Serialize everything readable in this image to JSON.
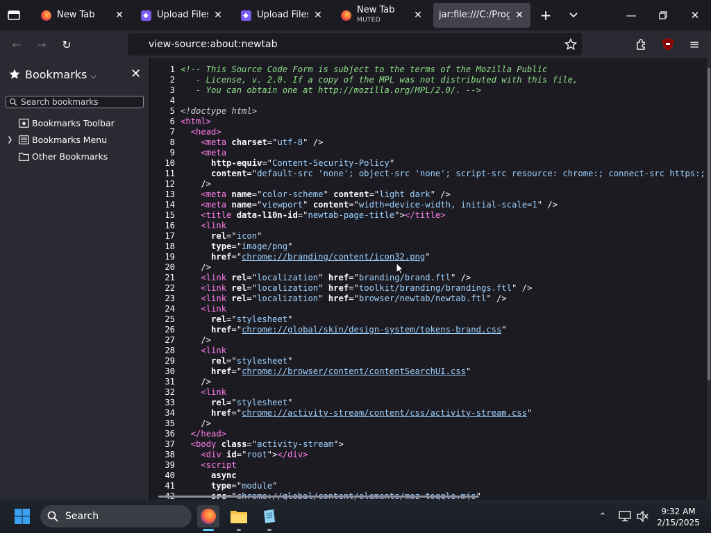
{
  "tabs": [
    {
      "title": "New Tab",
      "subtitle": "",
      "favicon": "firefox-icon",
      "active": false
    },
    {
      "title": "Upload Files | Fr",
      "subtitle": "",
      "favicon": "upload-site-icon",
      "active": false
    },
    {
      "title": "Upload Files | Fr",
      "subtitle": "",
      "favicon": "upload-site-icon",
      "active": false
    },
    {
      "title": "New Tab",
      "subtitle": "MUTED",
      "favicon": "firefox-icon",
      "active": false
    },
    {
      "title": "jar:file:///C:/Program",
      "subtitle": "",
      "favicon": "",
      "active": true
    }
  ],
  "navbar": {
    "url": "view-source:about:newtab"
  },
  "sidebar": {
    "title": "Bookmarks",
    "search_placeholder": "Search bookmarks",
    "items": [
      {
        "label": "Bookmarks Toolbar",
        "icon": "bookmarks-toolbar-icon",
        "expandable": false
      },
      {
        "label": "Bookmarks Menu",
        "icon": "bookmarks-menu-icon",
        "expandable": true
      },
      {
        "label": "Other Bookmarks",
        "icon": "folder-icon",
        "expandable": false
      }
    ]
  },
  "source": {
    "lines": [
      [
        [
          "cm",
          "<!-- This Source Code Form is subject to the terms of the Mozilla Public"
        ]
      ],
      [
        [
          "cm",
          "   - License, v. 2.0. If a copy of the MPL was not distributed with this file,"
        ]
      ],
      [
        [
          "cm",
          "   - You can obtain one at http://mozilla.org/MPL/2.0/. -->"
        ]
      ],
      [],
      [
        [
          "dt",
          "<!doctype html>"
        ]
      ],
      [
        [
          "tg",
          "<html"
        ],
        [
          "tg",
          ">"
        ]
      ],
      [
        [
          "pn",
          "  "
        ],
        [
          "tg",
          "<head"
        ],
        [
          "tg",
          ">"
        ]
      ],
      [
        [
          "pn",
          "    "
        ],
        [
          "tg",
          "<meta "
        ],
        [
          "at",
          "charset"
        ],
        [
          "pn",
          "=\""
        ],
        [
          "vl",
          "utf-8"
        ],
        [
          "pn",
          "\" />"
        ]
      ],
      [
        [
          "pn",
          "    "
        ],
        [
          "tg",
          "<meta"
        ]
      ],
      [
        [
          "pn",
          "      "
        ],
        [
          "at",
          "http-equiv"
        ],
        [
          "pn",
          "=\""
        ],
        [
          "vl",
          "Content-Security-Policy"
        ],
        [
          "pn",
          "\""
        ]
      ],
      [
        [
          "pn",
          "      "
        ],
        [
          "at",
          "content"
        ],
        [
          "pn",
          "=\""
        ],
        [
          "vl",
          "default-src 'none'; object-src 'none'; script-src resource: chrome:; connect-src https:; img"
        ]
      ],
      [
        [
          "pn",
          "    />"
        ]
      ],
      [
        [
          "pn",
          "    "
        ],
        [
          "tg",
          "<meta "
        ],
        [
          "at",
          "name"
        ],
        [
          "pn",
          "=\""
        ],
        [
          "vl",
          "color-scheme"
        ],
        [
          "pn",
          "\" "
        ],
        [
          "at",
          "content"
        ],
        [
          "pn",
          "=\""
        ],
        [
          "vl",
          "light dark"
        ],
        [
          "pn",
          "\" />"
        ]
      ],
      [
        [
          "pn",
          "    "
        ],
        [
          "tg",
          "<meta "
        ],
        [
          "at",
          "name"
        ],
        [
          "pn",
          "=\""
        ],
        [
          "vl",
          "viewport"
        ],
        [
          "pn",
          "\" "
        ],
        [
          "at",
          "content"
        ],
        [
          "pn",
          "=\""
        ],
        [
          "vl",
          "width=device-width, initial-scale=1"
        ],
        [
          "pn",
          "\" />"
        ]
      ],
      [
        [
          "pn",
          "    "
        ],
        [
          "tg",
          "<title "
        ],
        [
          "at",
          "data-l10n-id"
        ],
        [
          "pn",
          "=\""
        ],
        [
          "vl",
          "newtab-page-title"
        ],
        [
          "pn",
          "\">"
        ],
        [
          "tg",
          "</title>"
        ]
      ],
      [
        [
          "pn",
          "    "
        ],
        [
          "tg",
          "<link"
        ]
      ],
      [
        [
          "pn",
          "      "
        ],
        [
          "at",
          "rel"
        ],
        [
          "pn",
          "=\""
        ],
        [
          "vl",
          "icon"
        ],
        [
          "pn",
          "\""
        ]
      ],
      [
        [
          "pn",
          "      "
        ],
        [
          "at",
          "type"
        ],
        [
          "pn",
          "=\""
        ],
        [
          "vl",
          "image/png"
        ],
        [
          "pn",
          "\""
        ]
      ],
      [
        [
          "pn",
          "      "
        ],
        [
          "at",
          "href"
        ],
        [
          "pn",
          "=\""
        ],
        [
          "lk",
          "chrome://branding/content/icon32.png"
        ],
        [
          "pn",
          "\""
        ]
      ],
      [
        [
          "pn",
          "    />"
        ]
      ],
      [
        [
          "pn",
          "    "
        ],
        [
          "tg",
          "<link "
        ],
        [
          "at",
          "rel"
        ],
        [
          "pn",
          "=\""
        ],
        [
          "vl",
          "localization"
        ],
        [
          "pn",
          "\" "
        ],
        [
          "at",
          "href"
        ],
        [
          "pn",
          "=\""
        ],
        [
          "vl",
          "branding/brand.ftl"
        ],
        [
          "pn",
          "\" />"
        ]
      ],
      [
        [
          "pn",
          "    "
        ],
        [
          "tg",
          "<link "
        ],
        [
          "at",
          "rel"
        ],
        [
          "pn",
          "=\""
        ],
        [
          "vl",
          "localization"
        ],
        [
          "pn",
          "\" "
        ],
        [
          "at",
          "href"
        ],
        [
          "pn",
          "=\""
        ],
        [
          "vl",
          "toolkit/branding/brandings.ftl"
        ],
        [
          "pn",
          "\" />"
        ]
      ],
      [
        [
          "pn",
          "    "
        ],
        [
          "tg",
          "<link "
        ],
        [
          "at",
          "rel"
        ],
        [
          "pn",
          "=\""
        ],
        [
          "vl",
          "localization"
        ],
        [
          "pn",
          "\" "
        ],
        [
          "at",
          "href"
        ],
        [
          "pn",
          "=\""
        ],
        [
          "vl",
          "browser/newtab/newtab.ftl"
        ],
        [
          "pn",
          "\" />"
        ]
      ],
      [
        [
          "pn",
          "    "
        ],
        [
          "tg",
          "<link"
        ]
      ],
      [
        [
          "pn",
          "      "
        ],
        [
          "at",
          "rel"
        ],
        [
          "pn",
          "=\""
        ],
        [
          "vl",
          "stylesheet"
        ],
        [
          "pn",
          "\""
        ]
      ],
      [
        [
          "pn",
          "      "
        ],
        [
          "at",
          "href"
        ],
        [
          "pn",
          "=\""
        ],
        [
          "lk",
          "chrome://global/skin/design-system/tokens-brand.css"
        ],
        [
          "pn",
          "\""
        ]
      ],
      [
        [
          "pn",
          "    />"
        ]
      ],
      [
        [
          "pn",
          "    "
        ],
        [
          "tg",
          "<link"
        ]
      ],
      [
        [
          "pn",
          "      "
        ],
        [
          "at",
          "rel"
        ],
        [
          "pn",
          "=\""
        ],
        [
          "vl",
          "stylesheet"
        ],
        [
          "pn",
          "\""
        ]
      ],
      [
        [
          "pn",
          "      "
        ],
        [
          "at",
          "href"
        ],
        [
          "pn",
          "=\""
        ],
        [
          "lk",
          "chrome://browser/content/contentSearchUI.css"
        ],
        [
          "pn",
          "\""
        ]
      ],
      [
        [
          "pn",
          "    />"
        ]
      ],
      [
        [
          "pn",
          "    "
        ],
        [
          "tg",
          "<link"
        ]
      ],
      [
        [
          "pn",
          "      "
        ],
        [
          "at",
          "rel"
        ],
        [
          "pn",
          "=\""
        ],
        [
          "vl",
          "stylesheet"
        ],
        [
          "pn",
          "\""
        ]
      ],
      [
        [
          "pn",
          "      "
        ],
        [
          "at",
          "href"
        ],
        [
          "pn",
          "=\""
        ],
        [
          "lk",
          "chrome://activity-stream/content/css/activity-stream.css"
        ],
        [
          "pn",
          "\""
        ]
      ],
      [
        [
          "pn",
          "    />"
        ]
      ],
      [
        [
          "pn",
          "  "
        ],
        [
          "tg",
          "</head>"
        ]
      ],
      [
        [
          "pn",
          "  "
        ],
        [
          "tg",
          "<body "
        ],
        [
          "at",
          "class"
        ],
        [
          "pn",
          "=\""
        ],
        [
          "vl",
          "activity-stream"
        ],
        [
          "pn",
          "\">"
        ]
      ],
      [
        [
          "pn",
          "    "
        ],
        [
          "tg",
          "<div "
        ],
        [
          "at",
          "id"
        ],
        [
          "pn",
          "=\""
        ],
        [
          "vl",
          "root"
        ],
        [
          "pn",
          "\">"
        ],
        [
          "tg",
          "</div>"
        ]
      ],
      [
        [
          "pn",
          "    "
        ],
        [
          "tg",
          "<script"
        ]
      ],
      [
        [
          "pn",
          "      "
        ],
        [
          "at",
          "async"
        ]
      ],
      [
        [
          "pn",
          "      "
        ],
        [
          "at",
          "type"
        ],
        [
          "pn",
          "=\""
        ],
        [
          "vl",
          "module"
        ],
        [
          "pn",
          "\""
        ]
      ],
      [
        [
          "pn",
          "      "
        ],
        [
          "at",
          "src"
        ],
        [
          "pn",
          "=\""
        ],
        [
          "lk",
          "chrome://global/content/elements/moz-toggle.mjs"
        ],
        [
          "pn",
          "\""
        ]
      ]
    ]
  },
  "taskbar": {
    "search_label": "Search",
    "time": "9:32 AM",
    "date": "2/15/2025",
    "apps": [
      "firefox-app",
      "file-explorer-app",
      "notepad-app"
    ]
  },
  "colors": {
    "tab_active": "#42414d",
    "toolbar": "#2b2a33",
    "content": "#1c1b22",
    "comment": "#8fe089",
    "tag": "#ff7de9",
    "value": "#9fd3ff"
  }
}
